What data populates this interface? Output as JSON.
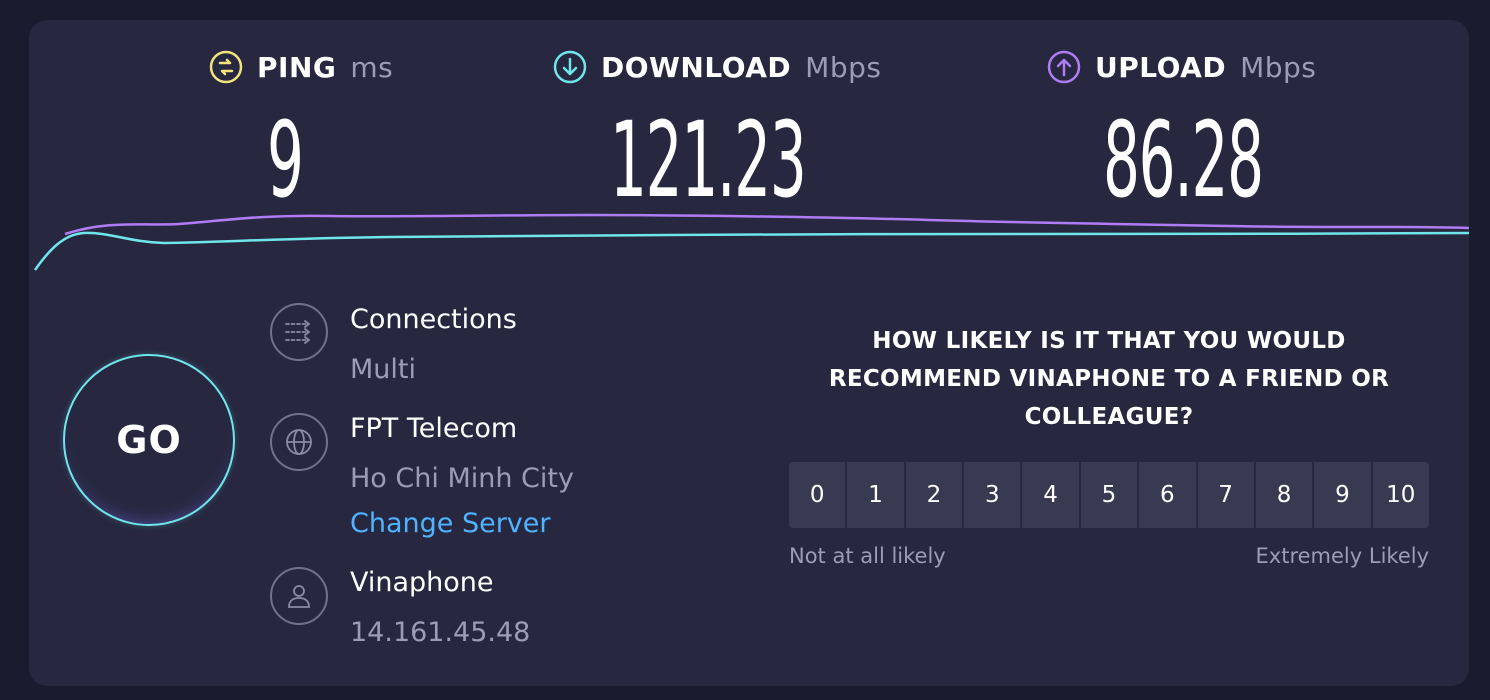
{
  "metrics": {
    "ping": {
      "label": "PING",
      "unit": "ms",
      "value": "9",
      "icon": "ping-icon",
      "color": "#f3e37c"
    },
    "download": {
      "label": "DOWNLOAD",
      "unit": "Mbps",
      "value": "121.23",
      "icon": "download-arrow-icon",
      "color": "#6fe6ea"
    },
    "upload": {
      "label": "UPLOAD",
      "unit": "Mbps",
      "value": "86.28",
      "icon": "upload-arrow-icon",
      "color": "#b07cf5"
    }
  },
  "go_button": {
    "label": "GO"
  },
  "connections": {
    "title": "Connections",
    "value": "Multi",
    "icon": "connections-icon"
  },
  "server": {
    "name": "FPT Telecom",
    "location": "Ho Chi Minh City",
    "change_link": "Change Server",
    "icon": "globe-icon"
  },
  "isp": {
    "name": "Vinaphone",
    "ip": "14.161.45.48",
    "icon": "user-icon"
  },
  "survey": {
    "question": "HOW LIKELY IS IT THAT YOU WOULD RECOMMEND VINAPHONE TO A FRIEND OR COLLEAGUE?",
    "options": [
      "0",
      "1",
      "2",
      "3",
      "4",
      "5",
      "6",
      "7",
      "8",
      "9",
      "10"
    ],
    "low_label": "Not at all likely",
    "high_label": "Extremely Likely"
  },
  "colors": {
    "background": "#1a1b2e",
    "panel": "#272840",
    "download_line": "#6fe6ea",
    "upload_line": "#b07cf5",
    "link": "#4fb3ff"
  }
}
